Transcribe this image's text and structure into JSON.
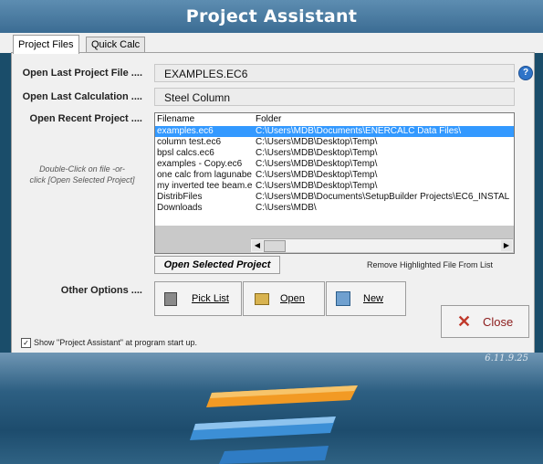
{
  "window": {
    "title": "Project Assistant",
    "version": "6.11.9.25"
  },
  "tabs": [
    {
      "label": "Project Files"
    },
    {
      "label": "Quick Calc"
    }
  ],
  "labels": {
    "open_last_project": "Open Last Project File ....",
    "open_last_calc": "Open Last Calculation ....",
    "open_recent": "Open Recent Project ....",
    "other_options": "Other Options ....",
    "hint_line1": "Double-Click on file -or-",
    "hint_line2": "click [Open Selected Project]"
  },
  "fields": {
    "last_project": "EXAMPLES.EC6",
    "last_calc": "Steel Column"
  },
  "help_icon": "?",
  "recent": {
    "headers": {
      "filename": "Filename",
      "folder": "Folder"
    },
    "rows": [
      {
        "filename": "examples.ec6",
        "folder": "C:\\Users\\MDB\\Documents\\ENERCALC Data Files\\",
        "selected": true
      },
      {
        "filename": "column test.ec6",
        "folder": "C:\\Users\\MDB\\Desktop\\Temp\\"
      },
      {
        "filename": "bpsl calcs.ec6",
        "folder": "C:\\Users\\MDB\\Desktop\\Temp\\"
      },
      {
        "filename": "examples - Copy.ec6",
        "folder": "C:\\Users\\MDB\\Desktop\\Temp\\"
      },
      {
        "filename": "one calc from lagunabe",
        "folder": "C:\\Users\\MDB\\Desktop\\Temp\\"
      },
      {
        "filename": "my inverted tee beam.e",
        "folder": "C:\\Users\\MDB\\Desktop\\Temp\\"
      },
      {
        "filename": "DistribFiles",
        "folder": "C:\\Users\\MDB\\Documents\\SetupBuilder Projects\\EC6_INSTAL"
      },
      {
        "filename": "Downloads",
        "folder": "C:\\Users\\MDB\\"
      }
    ]
  },
  "buttons": {
    "open_selected": "Open Selected Project",
    "remove_highlighted": "Remove Highlighted File From List",
    "pick_list": "Pick List",
    "open": "Open",
    "new": "New",
    "close": "Close"
  },
  "checkbox": {
    "label": "Show \"Project Assistant\" at program start up.",
    "checked": true
  },
  "colors": {
    "title_bar": "#4a7aa0",
    "selection": "#3399ff",
    "close_x": "#c0392b"
  }
}
